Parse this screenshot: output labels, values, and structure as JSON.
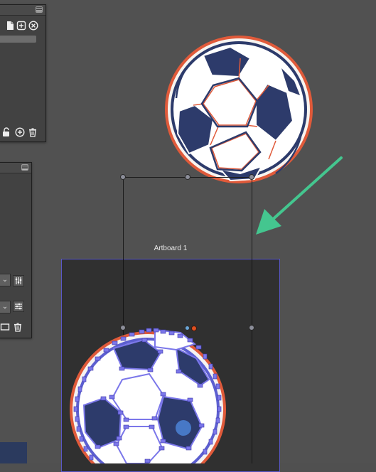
{
  "artboard": {
    "label": "Artboard 1"
  },
  "icons": {
    "panel_menu": "menu-icon",
    "new_file": "new-file-icon",
    "add": "add-icon",
    "close": "close-icon",
    "lock": "unlock-icon",
    "delete": "trash-icon",
    "chevron": "chevron-down-icon",
    "adjust": "sliders-icon",
    "rect": "rectangle-icon"
  },
  "colors": {
    "canvas_bg": "#515151",
    "panel_bg": "#424242",
    "artboard_bg": "#303030",
    "artboard_border": "#5a57c7",
    "arrow": "#44c68f",
    "ball_navy": "#2d3b6b",
    "ball_outline_red": "#e05a3a",
    "node_handles": "#7b77ea",
    "selection_point": "#e05020"
  }
}
